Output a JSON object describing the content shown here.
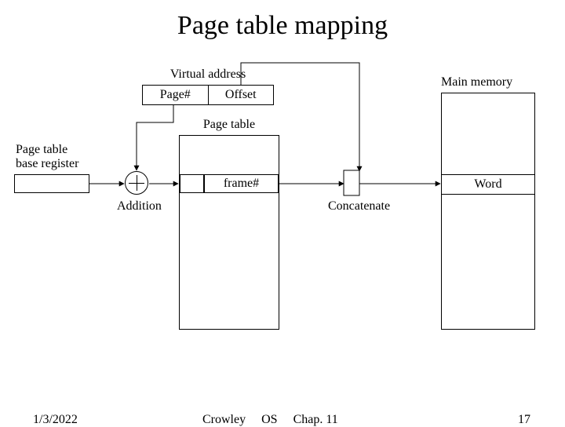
{
  "title": "Page table mapping",
  "labels": {
    "virtual_address": "Virtual address",
    "page_num": "Page#",
    "offset": "Offset",
    "ptbr1": "Page table",
    "ptbr2": "base register",
    "page_table": "Page table",
    "frame_num": "frame#",
    "addition": "Addition",
    "concatenate": "Concatenate",
    "main_memory": "Main memory",
    "word": "Word"
  },
  "footer": {
    "date": "1/3/2022",
    "author": "Crowley",
    "course": "OS",
    "chapter": "Chap. 11",
    "page": "17"
  }
}
